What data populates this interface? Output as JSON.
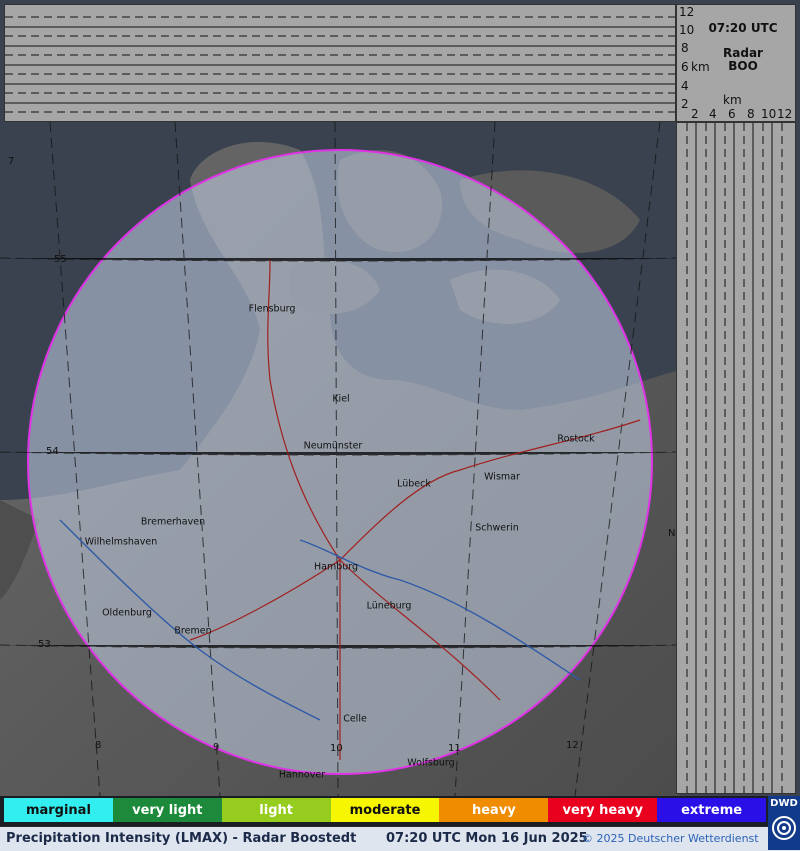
{
  "header": {
    "time_label": "07:20 UTC",
    "radar_label": "Radar",
    "radar_code": "BOO"
  },
  "height_axis": {
    "unit": "km",
    "ticks": [
      "12",
      "10",
      "8",
      "6",
      "4",
      "2"
    ]
  },
  "width_axis": {
    "unit": "km",
    "ticks": [
      "2",
      "4",
      "6",
      "8",
      "10",
      "12"
    ]
  },
  "map": {
    "coverage_color": "#e032e6",
    "cities": [
      {
        "name": "Flensburg"
      },
      {
        "name": "Kiel"
      },
      {
        "name": "Neumünster"
      },
      {
        "name": "Lübeck"
      },
      {
        "name": "Wismar"
      },
      {
        "name": "Rostock"
      },
      {
        "name": "Schwerin"
      },
      {
        "name": "Hamburg"
      },
      {
        "name": "Lüneburg"
      },
      {
        "name": "Bremerhaven"
      },
      {
        "name": "Wilhelmshaven"
      },
      {
        "name": "Oldenburg"
      },
      {
        "name": "Bremen"
      },
      {
        "name": "Celle"
      },
      {
        "name": "Wolfsburg"
      },
      {
        "name": "Hannover"
      }
    ],
    "lat_labels": [
      "55",
      "54",
      "53"
    ],
    "lon_labels": [
      "8",
      "9",
      "10",
      "11",
      "12"
    ],
    "edge_labels": [
      "7",
      "N"
    ]
  },
  "legend": [
    {
      "label": "marginal",
      "color": "#33eeee",
      "text_color": "#111"
    },
    {
      "label": "very light",
      "color": "#1c8a3a",
      "text_color": "#fff"
    },
    {
      "label": "light",
      "color": "#96cc1e",
      "text_color": "#fff"
    },
    {
      "label": "moderate",
      "color": "#f6f600",
      "text_color": "#111"
    },
    {
      "label": "heavy",
      "color": "#f08c00",
      "text_color": "#fff"
    },
    {
      "label": "very heavy",
      "color": "#e8001e",
      "text_color": "#fff"
    },
    {
      "label": "extreme",
      "color": "#2a10e6",
      "text_color": "#fff"
    }
  ],
  "footer": {
    "product": "Precipitation Intensity (LMAX) - Radar Boostedt",
    "timestamp": "07:20 UTC Mon 16 Jun 2025",
    "copyright": "© 2025 Deutscher Wetterdienst"
  },
  "logo": {
    "text": "DWD"
  }
}
